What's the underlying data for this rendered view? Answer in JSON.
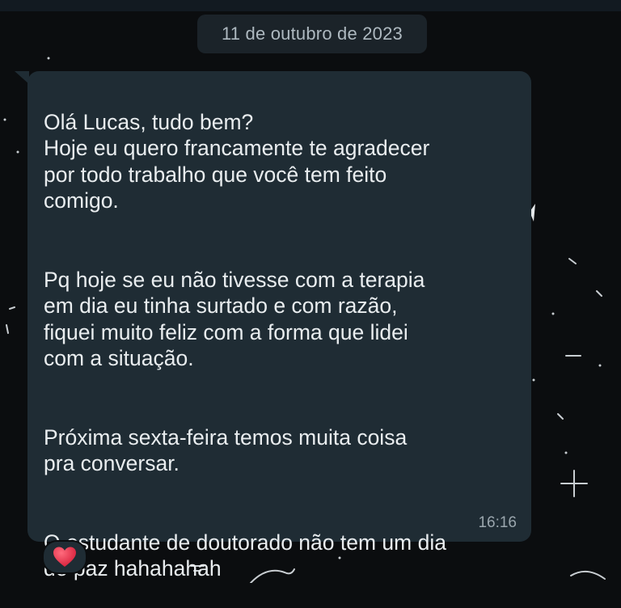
{
  "chat": {
    "date_label": "11 de outubro de 2023",
    "message": {
      "paragraphs": [
        "Olá Lucas, tudo bem?\nHoje eu quero francamente te agradecer\npor todo trabalho que você tem feito\ncomigo.",
        "Pq hoje se eu não tivesse com a terapia\nem dia eu tinha surtado e com razão,\nfiquei muito feliz com a forma que lidei\ncom a situação.",
        "Próxima sexta-feira temos muita coisa\npra conversar.",
        "O estudante de doutorado não tem um dia\nde paz hahahahah"
      ],
      "time": "16:16",
      "reaction_icon": "heart-icon"
    }
  },
  "colors": {
    "background": "#0b0d0f",
    "bubble": "#1f2c34",
    "text": "#e9edef",
    "meta_text": "#9aa6ad",
    "reaction_heart": "#e8384f"
  }
}
